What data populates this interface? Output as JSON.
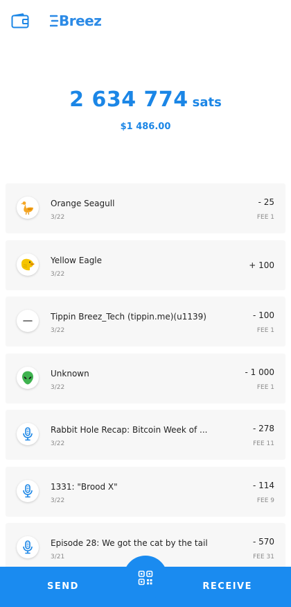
{
  "header": {
    "logo_text": "Breez",
    "brand_color": "#1b86e6"
  },
  "balance": {
    "amount": "2 634 774",
    "unit": "sats",
    "fiat": "$1 486.00"
  },
  "transactions": [
    {
      "title": "Orange Seagull",
      "date": "3/22",
      "amount": "- 25",
      "fee": "FEE 1",
      "icon": "orange-seagull-icon"
    },
    {
      "title": "Yellow Eagle",
      "date": "3/22",
      "amount": "+ 100",
      "fee": "",
      "icon": "yellow-eagle-icon"
    },
    {
      "title": "Tippin Breez_Tech (tippin.me)(u1139)",
      "date": "3/22",
      "amount": "- 100",
      "fee": "FEE 1",
      "icon": "minus-icon"
    },
    {
      "title": "Unknown",
      "date": "3/22",
      "amount": "- 1 000",
      "fee": "FEE 1",
      "icon": "alien-icon"
    },
    {
      "title": "Rabbit Hole Recap: Bitcoin Week of ...",
      "date": "3/22",
      "amount": "- 278",
      "fee": "FEE 11",
      "icon": "microphone-icon"
    },
    {
      "title": "1331: \"Brood X\"",
      "date": "3/22",
      "amount": "- 114",
      "fee": "FEE 9",
      "icon": "microphone-icon"
    },
    {
      "title": "Episode 28: We got the cat by the tail",
      "date": "3/21",
      "amount": "- 570",
      "fee": "FEE 31",
      "icon": "microphone-icon"
    }
  ],
  "bottom_bar": {
    "send_label": "SEND",
    "receive_label": "RECEIVE",
    "scan_icon": "qr-scan-icon"
  }
}
